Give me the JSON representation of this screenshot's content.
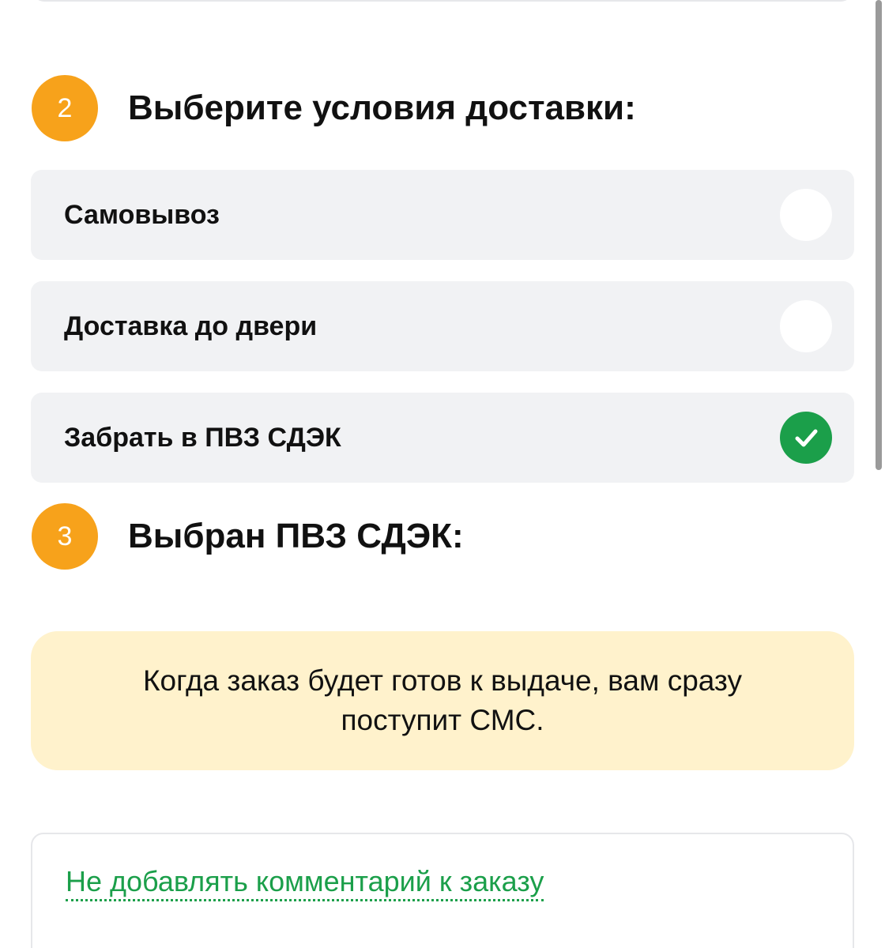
{
  "step2": {
    "number": "2",
    "title": "Выберите условия доставки:"
  },
  "delivery_options": [
    {
      "label": "Самовывоз",
      "selected": false
    },
    {
      "label": "Доставка до двери",
      "selected": false
    },
    {
      "label": "Забрать в ПВЗ СДЭК",
      "selected": true
    }
  ],
  "step3": {
    "number": "3",
    "title": "Выбран ПВЗ СДЭК:"
  },
  "notice": {
    "text": "Когда заказ будет готов к выдаче, вам сразу поступит СМС."
  },
  "comment": {
    "link_label": "Не добавлять комментарий к заказу"
  },
  "colors": {
    "accent_orange": "#f7a21b",
    "accent_green": "#1b9f4a",
    "option_bg": "#f1f2f4",
    "notice_bg": "#fff2cc"
  }
}
